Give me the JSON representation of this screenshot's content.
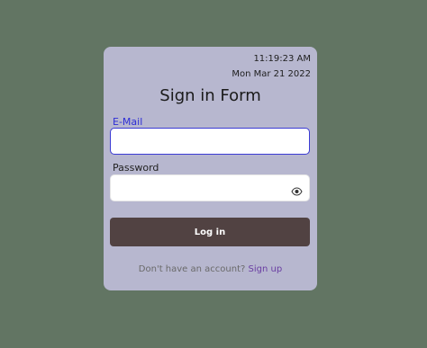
{
  "clock": {
    "time": "11:19:23 AM",
    "date": "Mon Mar 21 2022"
  },
  "form": {
    "title": "Sign in Form",
    "email_label": "E-Mail",
    "email_value": "",
    "password_label": "Password",
    "password_value": "",
    "login_label": "Log in",
    "footer_text": "Don't have an account?",
    "signup_link": "Sign up"
  },
  "icons": {
    "password_toggle": "eye-icon"
  },
  "colors": {
    "page_background": "#627563",
    "card_background": "#b7b7cf",
    "accent": "#3b3bd4",
    "button_background": "#514242",
    "link": "#6a3ea2"
  }
}
